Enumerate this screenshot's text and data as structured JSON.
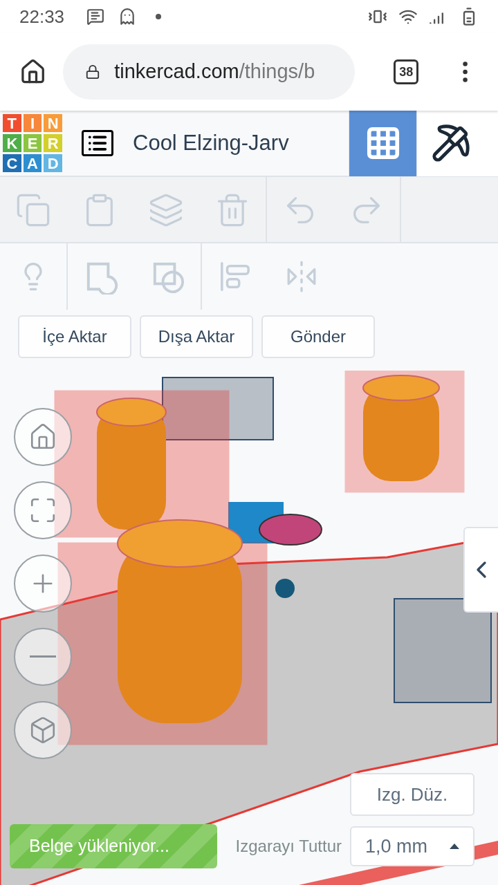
{
  "status_bar": {
    "time": "22:33"
  },
  "browser": {
    "url_host": "tinkercad.com",
    "url_path": "/things/b",
    "tab_count": "38"
  },
  "app_header": {
    "logo_letters": [
      {
        "letter": "T",
        "color": "#f04e2f"
      },
      {
        "letter": "I",
        "color": "#f7873a"
      },
      {
        "letter": "N",
        "color": "#f89c39"
      },
      {
        "letter": "K",
        "color": "#4fae48"
      },
      {
        "letter": "E",
        "color": "#8cc540"
      },
      {
        "letter": "R",
        "color": "#d3cf2b"
      },
      {
        "letter": "C",
        "color": "#1f6fb4"
      },
      {
        "letter": "A",
        "color": "#2d8fd0"
      },
      {
        "letter": "D",
        "color": "#62b6e3"
      }
    ],
    "title": "Cool Elzing-Jarv",
    "views": [
      {
        "kind": "grid",
        "selected": true
      },
      {
        "kind": "pickaxe",
        "selected": false
      }
    ]
  },
  "edit_toolbar": [
    {
      "kind": "copy",
      "disabled": true
    },
    {
      "kind": "paste",
      "disabled": true
    },
    {
      "kind": "duplicate",
      "disabled": true
    },
    {
      "kind": "delete",
      "disabled": true
    },
    {
      "kind": "undo",
      "disabled": true
    },
    {
      "kind": "redo",
      "disabled": true
    }
  ],
  "shape_toolbar": [
    {
      "kind": "light",
      "disabled": true
    },
    {
      "kind": "group",
      "disabled": true
    },
    {
      "kind": "ungroup",
      "disabled": true
    },
    {
      "kind": "align",
      "disabled": true
    },
    {
      "kind": "mirror",
      "disabled": true
    }
  ],
  "actions": [
    {
      "label": "İçe Aktar"
    },
    {
      "label": "Dışa Aktar"
    },
    {
      "label": "Gönder"
    }
  ],
  "view_controls": [
    {
      "kind": "home"
    },
    {
      "kind": "fit"
    },
    {
      "kind": "zoom_in"
    },
    {
      "kind": "zoom_out"
    },
    {
      "kind": "perspective"
    }
  ],
  "edit_grid_button": "Izg. Düz.",
  "snap_grid": {
    "label": "Izgarayı Tuttur",
    "value": "1,0 mm"
  },
  "toast": {
    "message": "Belge yükleniyor..."
  }
}
